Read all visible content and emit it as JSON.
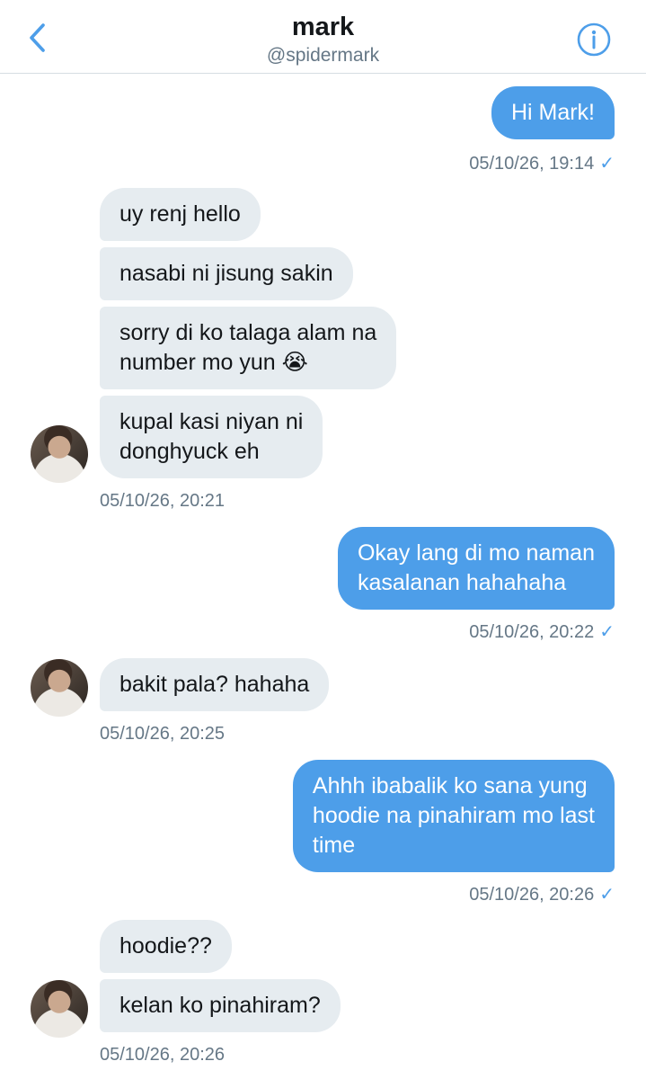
{
  "header": {
    "title": "mark",
    "handle": "@spidermark",
    "back_icon": "chevron-left-icon",
    "info_icon": "info-circle-icon",
    "accent_color": "#4d9ee9"
  },
  "messages": [
    {
      "side": "sent",
      "text": "Hi Mark!"
    },
    {
      "side": "sent_ts",
      "text": "05/10/26, 19:14"
    },
    {
      "side": "recv",
      "text": "uy renj hello"
    },
    {
      "side": "recv",
      "text": "nasabi ni jisung sakin"
    },
    {
      "side": "recv",
      "text": "sorry di ko talaga alam na\nnumber mo yun 😭"
    },
    {
      "side": "recv",
      "text": "kupal kasi niyan ni\ndonghyuck eh"
    },
    {
      "side": "recv_ts",
      "text": "05/10/26, 20:21"
    },
    {
      "side": "sent",
      "text": "Okay lang di mo naman\nkasalanan hahahaha"
    },
    {
      "side": "sent_ts",
      "text": "05/10/26, 20:22"
    },
    {
      "side": "recv",
      "text": "bakit pala? hahaha"
    },
    {
      "side": "recv_ts",
      "text": "05/10/26, 20:25"
    },
    {
      "side": "sent",
      "text": "Ahhh ibabalik ko sana yung\nhoodie na pinahiram mo last\ntime"
    },
    {
      "side": "sent_ts",
      "text": "05/10/26, 20:26"
    },
    {
      "side": "recv",
      "text": "hoodie??"
    },
    {
      "side": "recv",
      "text": "kelan ko pinahiram?"
    },
    {
      "side": "recv_ts",
      "text": "05/10/26, 20:26"
    }
  ]
}
